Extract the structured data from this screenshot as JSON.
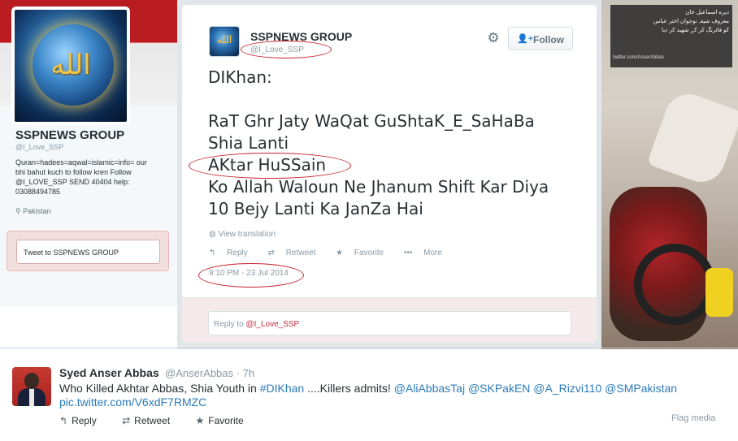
{
  "profile": {
    "name": "SSPNEWS GROUP",
    "handle": "@I_Love_SSP",
    "bio": "Quran=hadees=aqwal=islamic=info= our bhi bahut kuch to follow kren Follow @I_LOVE_SSP SEND 40404 help: 03088494785",
    "location": "Pakistan",
    "tweet_to_label": "Tweet to SSPNEWS GROUP"
  },
  "card": {
    "name": "SSPNEWS GROUP",
    "handle": "@I_Love_SSP",
    "follow_label": "Follow",
    "text_lines": [
      "DIKhan:",
      "",
      "RaT Ghr Jaty WaQat GuShtaK_E_SaHaBa",
      "Shia Lanti",
      "AKtar HuSSain",
      "Ko Allah Waloun Ne Jhanum Shift Kar Diya",
      "10 Bejy Lanti Ka JanZa Hai"
    ],
    "view_translation": "View translation",
    "actions": {
      "reply": "Reply",
      "retweet": "Retweet",
      "favorite": "Favorite",
      "more": "More"
    },
    "timestamp": "9:10 PM - 23 Jul 2014",
    "reply_prefix": "Reply to ",
    "reply_mention": "@I_Love_SSP"
  },
  "photo": {
    "url_text": "twitter.com/AnserAbbas"
  },
  "bottom_tweet": {
    "name": "Syed Anser Abbas",
    "handle_time": "@AnserAbbas · 7h",
    "text_a": "Who Killed Akhtar Abbas, Shia Youth in ",
    "hashtag": "#DIKhan",
    "text_b": " ....Killers admits!  ",
    "mentions": "@AliAbbasTaj @SKPakEN @A_Rizvi110 @SMPakistan",
    "pic_link": "pic.twitter.com/V6xdF7RMZC",
    "actions": {
      "reply": "Reply",
      "retweet": "Retweet",
      "favorite": "Favorite"
    },
    "flag_media": "Flag media"
  },
  "icons": {
    "gear": "gear-icon",
    "follow": "add-person-icon",
    "globe": "globe-icon",
    "reply": "reply-arrow-icon",
    "retweet": "retweet-icon",
    "favorite": "star-icon",
    "more": "dots-icon",
    "location": "pin-icon"
  },
  "colors": {
    "annotation_red": "#c8202a",
    "link_blue": "#2b7bb9",
    "banner_red": "#b81c20"
  }
}
